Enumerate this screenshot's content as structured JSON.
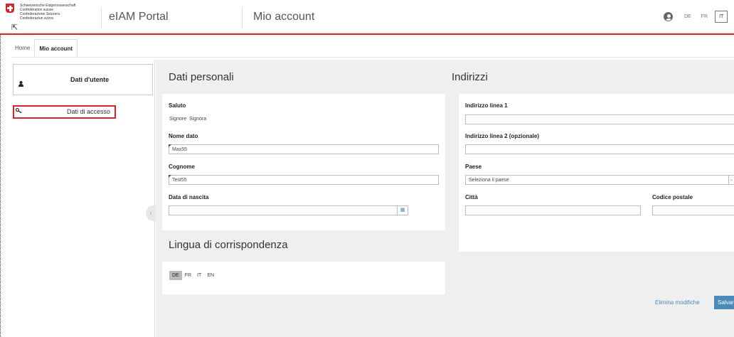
{
  "header": {
    "logo_lines": [
      "Schweizerische Eidgenossenschaft",
      "Confédération suisse",
      "Confederazione Svizzera",
      "Confederaziun svizra"
    ],
    "portal_title": "eIAM Portal",
    "page_heading": "Mio account",
    "languages": [
      "DE",
      "FR",
      "IT"
    ],
    "active_language": "IT"
  },
  "breadcrumb": [
    "Home",
    "Mio account"
  ],
  "sidebar": {
    "items": [
      {
        "label": "Dati d'utente",
        "icon": "person-icon"
      },
      {
        "label": "Dati di accesso",
        "icon": "key-icon"
      }
    ]
  },
  "personal": {
    "title": "Dati personali",
    "salutation_label": "Saluto",
    "salutation_options": [
      "Signore",
      "Signora"
    ],
    "first_name_label": "Nome dato",
    "first_name_value": "Max55",
    "last_name_label": "Cognome",
    "last_name_value": "Test55",
    "birthdate_label": "Data di nascita",
    "birthdate_value": ""
  },
  "correspondence": {
    "title": "Lingua di corrispondenza",
    "options": [
      "DE",
      "FR",
      "IT",
      "EN"
    ],
    "selected": "DE"
  },
  "addresses": {
    "title": "Indirizzi",
    "line1_label": "Indirizzo linea 1",
    "line1_value": "",
    "line2_label": "Indirizzo linea 2 (opzionale)",
    "line2_value": "",
    "country_label": "Paese",
    "country_value": "Seleziona il paese",
    "city_label": "Città",
    "city_value": "",
    "postal_label": "Codice postale",
    "postal_value": ""
  },
  "actions": {
    "discard_label": "Elimina modifiche",
    "save_label": "Salvar"
  },
  "colors": {
    "accent_red": "#d8232a",
    "link_blue": "#4a8ab8"
  }
}
